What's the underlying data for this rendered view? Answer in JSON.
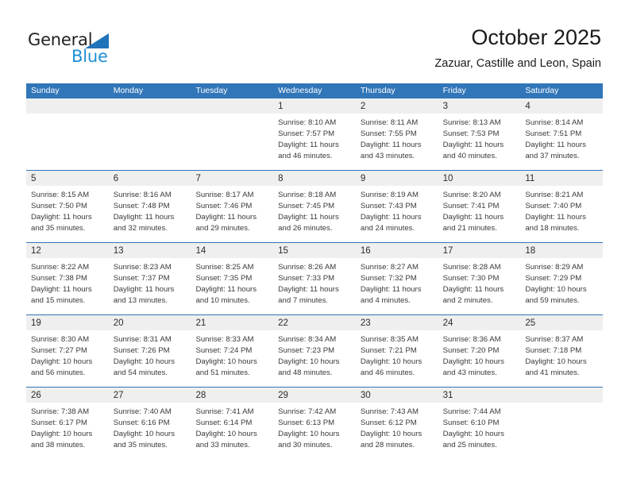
{
  "brand": {
    "name_part1": "General",
    "name_part2": "Blue",
    "triangle_color": "#1f73b8",
    "blue_color": "#1f8fd6"
  },
  "header": {
    "title": "October 2025",
    "subtitle": "Zazuar, Castille and Leon, Spain"
  },
  "theme": {
    "header_row_color": "#3176b8",
    "day_band_color": "#efefef",
    "text_color": "#3a3a3a"
  },
  "weekdays": [
    "Sunday",
    "Monday",
    "Tuesday",
    "Wednesday",
    "Thursday",
    "Friday",
    "Saturday"
  ],
  "weeks": [
    [
      {
        "day": "",
        "sunrise": "",
        "sunset": "",
        "daylight1": "",
        "daylight2": ""
      },
      {
        "day": "",
        "sunrise": "",
        "sunset": "",
        "daylight1": "",
        "daylight2": ""
      },
      {
        "day": "",
        "sunrise": "",
        "sunset": "",
        "daylight1": "",
        "daylight2": ""
      },
      {
        "day": "1",
        "sunrise": "Sunrise: 8:10 AM",
        "sunset": "Sunset: 7:57 PM",
        "daylight1": "Daylight: 11 hours",
        "daylight2": "and 46 minutes."
      },
      {
        "day": "2",
        "sunrise": "Sunrise: 8:11 AM",
        "sunset": "Sunset: 7:55 PM",
        "daylight1": "Daylight: 11 hours",
        "daylight2": "and 43 minutes."
      },
      {
        "day": "3",
        "sunrise": "Sunrise: 8:13 AM",
        "sunset": "Sunset: 7:53 PM",
        "daylight1": "Daylight: 11 hours",
        "daylight2": "and 40 minutes."
      },
      {
        "day": "4",
        "sunrise": "Sunrise: 8:14 AM",
        "sunset": "Sunset: 7:51 PM",
        "daylight1": "Daylight: 11 hours",
        "daylight2": "and 37 minutes."
      }
    ],
    [
      {
        "day": "5",
        "sunrise": "Sunrise: 8:15 AM",
        "sunset": "Sunset: 7:50 PM",
        "daylight1": "Daylight: 11 hours",
        "daylight2": "and 35 minutes."
      },
      {
        "day": "6",
        "sunrise": "Sunrise: 8:16 AM",
        "sunset": "Sunset: 7:48 PM",
        "daylight1": "Daylight: 11 hours",
        "daylight2": "and 32 minutes."
      },
      {
        "day": "7",
        "sunrise": "Sunrise: 8:17 AM",
        "sunset": "Sunset: 7:46 PM",
        "daylight1": "Daylight: 11 hours",
        "daylight2": "and 29 minutes."
      },
      {
        "day": "8",
        "sunrise": "Sunrise: 8:18 AM",
        "sunset": "Sunset: 7:45 PM",
        "daylight1": "Daylight: 11 hours",
        "daylight2": "and 26 minutes."
      },
      {
        "day": "9",
        "sunrise": "Sunrise: 8:19 AM",
        "sunset": "Sunset: 7:43 PM",
        "daylight1": "Daylight: 11 hours",
        "daylight2": "and 24 minutes."
      },
      {
        "day": "10",
        "sunrise": "Sunrise: 8:20 AM",
        "sunset": "Sunset: 7:41 PM",
        "daylight1": "Daylight: 11 hours",
        "daylight2": "and 21 minutes."
      },
      {
        "day": "11",
        "sunrise": "Sunrise: 8:21 AM",
        "sunset": "Sunset: 7:40 PM",
        "daylight1": "Daylight: 11 hours",
        "daylight2": "and 18 minutes."
      }
    ],
    [
      {
        "day": "12",
        "sunrise": "Sunrise: 8:22 AM",
        "sunset": "Sunset: 7:38 PM",
        "daylight1": "Daylight: 11 hours",
        "daylight2": "and 15 minutes."
      },
      {
        "day": "13",
        "sunrise": "Sunrise: 8:23 AM",
        "sunset": "Sunset: 7:37 PM",
        "daylight1": "Daylight: 11 hours",
        "daylight2": "and 13 minutes."
      },
      {
        "day": "14",
        "sunrise": "Sunrise: 8:25 AM",
        "sunset": "Sunset: 7:35 PM",
        "daylight1": "Daylight: 11 hours",
        "daylight2": "and 10 minutes."
      },
      {
        "day": "15",
        "sunrise": "Sunrise: 8:26 AM",
        "sunset": "Sunset: 7:33 PM",
        "daylight1": "Daylight: 11 hours",
        "daylight2": "and 7 minutes."
      },
      {
        "day": "16",
        "sunrise": "Sunrise: 8:27 AM",
        "sunset": "Sunset: 7:32 PM",
        "daylight1": "Daylight: 11 hours",
        "daylight2": "and 4 minutes."
      },
      {
        "day": "17",
        "sunrise": "Sunrise: 8:28 AM",
        "sunset": "Sunset: 7:30 PM",
        "daylight1": "Daylight: 11 hours",
        "daylight2": "and 2 minutes."
      },
      {
        "day": "18",
        "sunrise": "Sunrise: 8:29 AM",
        "sunset": "Sunset: 7:29 PM",
        "daylight1": "Daylight: 10 hours",
        "daylight2": "and 59 minutes."
      }
    ],
    [
      {
        "day": "19",
        "sunrise": "Sunrise: 8:30 AM",
        "sunset": "Sunset: 7:27 PM",
        "daylight1": "Daylight: 10 hours",
        "daylight2": "and 56 minutes."
      },
      {
        "day": "20",
        "sunrise": "Sunrise: 8:31 AM",
        "sunset": "Sunset: 7:26 PM",
        "daylight1": "Daylight: 10 hours",
        "daylight2": "and 54 minutes."
      },
      {
        "day": "21",
        "sunrise": "Sunrise: 8:33 AM",
        "sunset": "Sunset: 7:24 PM",
        "daylight1": "Daylight: 10 hours",
        "daylight2": "and 51 minutes."
      },
      {
        "day": "22",
        "sunrise": "Sunrise: 8:34 AM",
        "sunset": "Sunset: 7:23 PM",
        "daylight1": "Daylight: 10 hours",
        "daylight2": "and 48 minutes."
      },
      {
        "day": "23",
        "sunrise": "Sunrise: 8:35 AM",
        "sunset": "Sunset: 7:21 PM",
        "daylight1": "Daylight: 10 hours",
        "daylight2": "and 46 minutes."
      },
      {
        "day": "24",
        "sunrise": "Sunrise: 8:36 AM",
        "sunset": "Sunset: 7:20 PM",
        "daylight1": "Daylight: 10 hours",
        "daylight2": "and 43 minutes."
      },
      {
        "day": "25",
        "sunrise": "Sunrise: 8:37 AM",
        "sunset": "Sunset: 7:18 PM",
        "daylight1": "Daylight: 10 hours",
        "daylight2": "and 41 minutes."
      }
    ],
    [
      {
        "day": "26",
        "sunrise": "Sunrise: 7:38 AM",
        "sunset": "Sunset: 6:17 PM",
        "daylight1": "Daylight: 10 hours",
        "daylight2": "and 38 minutes."
      },
      {
        "day": "27",
        "sunrise": "Sunrise: 7:40 AM",
        "sunset": "Sunset: 6:16 PM",
        "daylight1": "Daylight: 10 hours",
        "daylight2": "and 35 minutes."
      },
      {
        "day": "28",
        "sunrise": "Sunrise: 7:41 AM",
        "sunset": "Sunset: 6:14 PM",
        "daylight1": "Daylight: 10 hours",
        "daylight2": "and 33 minutes."
      },
      {
        "day": "29",
        "sunrise": "Sunrise: 7:42 AM",
        "sunset": "Sunset: 6:13 PM",
        "daylight1": "Daylight: 10 hours",
        "daylight2": "and 30 minutes."
      },
      {
        "day": "30",
        "sunrise": "Sunrise: 7:43 AM",
        "sunset": "Sunset: 6:12 PM",
        "daylight1": "Daylight: 10 hours",
        "daylight2": "and 28 minutes."
      },
      {
        "day": "31",
        "sunrise": "Sunrise: 7:44 AM",
        "sunset": "Sunset: 6:10 PM",
        "daylight1": "Daylight: 10 hours",
        "daylight2": "and 25 minutes."
      },
      {
        "day": "",
        "sunrise": "",
        "sunset": "",
        "daylight1": "",
        "daylight2": ""
      }
    ]
  ]
}
